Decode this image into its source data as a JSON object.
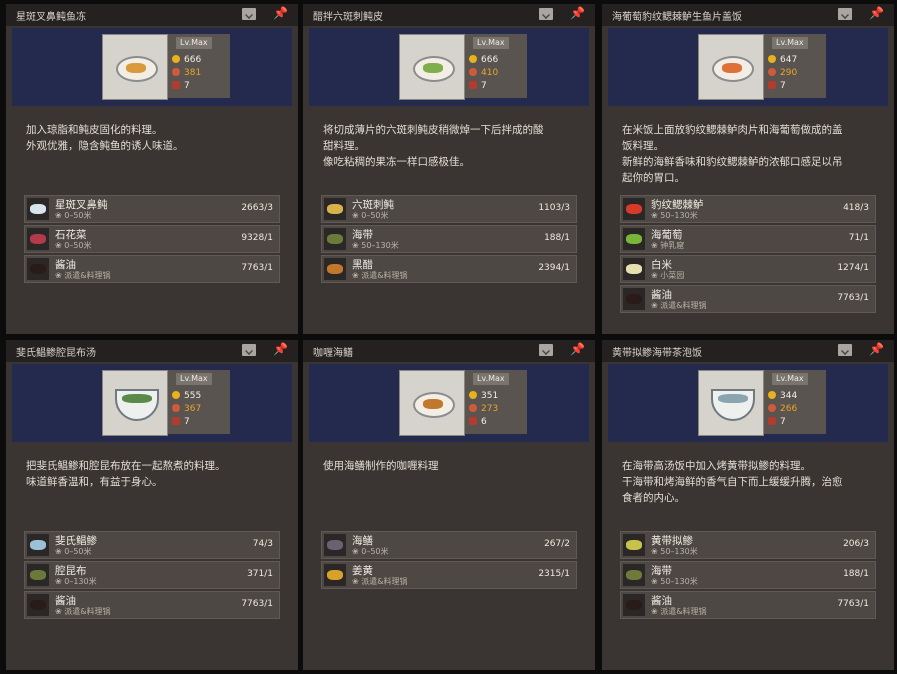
{
  "panels": [
    {
      "title": "星斑叉鼻鲀鱼冻",
      "level": "Lv.Max",
      "stats": [
        "666",
        "381",
        "7"
      ],
      "food_color": "#d99a3c",
      "description": [
        "加入琼脂和鲀皮固化的料理。",
        "外观优雅，隐含鲀鱼的诱人味道。"
      ],
      "ingredients": [
        {
          "name": "星斑叉鼻鲀",
          "location": "0–50米",
          "count": "2663/3",
          "icon": "puffer-fish-icon",
          "color": "#d8e4ec"
        },
        {
          "name": "石花菜",
          "location": "0–50米",
          "count": "9328/1",
          "icon": "red-seaweed-icon",
          "color": "#b23a4a"
        },
        {
          "name": "酱油",
          "location": "派遣&料理锅",
          "count": "7763/1",
          "icon": "soy-sauce-icon",
          "color": "#2a1a18"
        }
      ]
    },
    {
      "title": "醋拌六斑刺鲀皮",
      "level": "Lv.Max",
      "stats": [
        "666",
        "410",
        "7"
      ],
      "food_color": "#7fae4a",
      "description": [
        "将切成薄片的六斑刺鲀皮稍微焯一下后拌成的酸",
        "甜料理。",
        "像吃粘稠的果冻一样口感极佳。"
      ],
      "ingredients": [
        {
          "name": "六斑刺鲀",
          "location": "0–50米",
          "count": "1103/3",
          "icon": "porcupine-fish-icon",
          "color": "#d8b24a"
        },
        {
          "name": "海带",
          "location": "50–130米",
          "count": "188/1",
          "icon": "kelp-icon",
          "color": "#6e7a3a"
        },
        {
          "name": "黑醋",
          "location": "派遣&料理锅",
          "count": "2394/1",
          "icon": "vinegar-icon",
          "color": "#c0782a"
        }
      ]
    },
    {
      "title": "海葡萄豹纹鳃棘鲈生鱼片盖饭",
      "level": "Lv.Max",
      "stats": [
        "647",
        "290",
        "7"
      ],
      "food_color": "#e0703a",
      "description": [
        "在米饭上面放豹纹鳃棘鲈肉片和海葡萄做成的盖",
        "饭料理。",
        "新鲜的海鲜香味和豹纹鳃棘鲈的浓郁口感足以吊",
        "起你的胃口。"
      ],
      "ingredients": [
        {
          "name": "豹纹鳃棘鲈",
          "location": "50–130米",
          "count": "418/3",
          "icon": "coral-trout-icon",
          "color": "#d83a2a"
        },
        {
          "name": "海葡萄",
          "location": "钟乳窟",
          "count": "71/1",
          "icon": "sea-grapes-icon",
          "color": "#7ab43a"
        },
        {
          "name": "白米",
          "location": "小菜园",
          "count": "1274/1",
          "icon": "rice-icon",
          "color": "#e8dfae"
        },
        {
          "name": "酱油",
          "location": "派遣&料理锅",
          "count": "7763/1",
          "icon": "soy-sauce-icon",
          "color": "#2a1a18"
        }
      ]
    },
    {
      "title": "斐氏鲳鲹腔昆布汤",
      "level": "Lv.Max",
      "stats": [
        "555",
        "367",
        "7"
      ],
      "food_color": "#5a8a4a",
      "description": [
        "把斐氏鲳鲹和腔昆布放在一起熬煮的料理。",
        "味道鲜香温和，有益于身心。"
      ],
      "ingredients": [
        {
          "name": "斐氏鲳鲹",
          "location": "0–50米",
          "count": "74/3",
          "icon": "pompano-fish-icon",
          "color": "#9cc0d8"
        },
        {
          "name": "腔昆布",
          "location": "0–130米",
          "count": "371/1",
          "icon": "kelp-icon",
          "color": "#6a7a3a"
        },
        {
          "name": "酱油",
          "location": "派遣&料理锅",
          "count": "7763/1",
          "icon": "soy-sauce-icon",
          "color": "#2a1a18"
        }
      ]
    },
    {
      "title": "咖喱海鳝",
      "level": "Lv.Max",
      "stats": [
        "351",
        "273",
        "6"
      ],
      "food_color": "#c0782a",
      "description": [
        "使用海鳝制作的咖喱料理"
      ],
      "ingredients": [
        {
          "name": "海鳝",
          "location": "0–50米",
          "count": "267/2",
          "icon": "eel-icon",
          "color": "#6a6270"
        },
        {
          "name": "姜黄",
          "location": "派遣&料理锅",
          "count": "2315/1",
          "icon": "turmeric-icon",
          "color": "#d8a22a"
        }
      ]
    },
    {
      "title": "黄带拟鲹海带茶泡饭",
      "level": "Lv.Max",
      "stats": [
        "344",
        "266",
        "7"
      ],
      "food_color": "#8aa4b0",
      "description": [
        "在海带高汤饭中加入烤黄带拟鲹的料理。",
        "干海带和烤海鲜的香气自下而上缓缓升腾，治愈",
        "食者的内心。"
      ],
      "ingredients": [
        {
          "name": "黄带拟鲹",
          "location": "50–130米",
          "count": "206/3",
          "icon": "yellowtail-fish-icon",
          "color": "#c8c24a"
        },
        {
          "name": "海带",
          "location": "50–130米",
          "count": "188/1",
          "icon": "kelp-icon",
          "color": "#6e7a3a"
        },
        {
          "name": "酱油",
          "location": "派遣&料理锅",
          "count": "7763/1",
          "icon": "soy-sauce-icon",
          "color": "#2a1a18"
        }
      ]
    }
  ]
}
